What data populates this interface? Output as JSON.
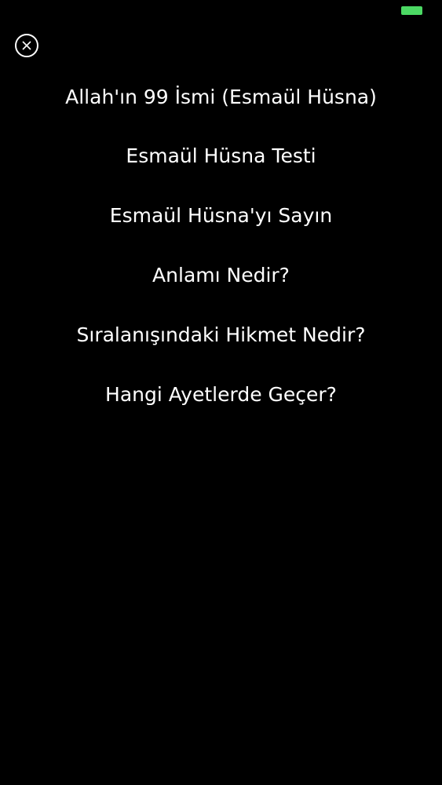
{
  "status_bar": {
    "battery_icon": "battery-icon",
    "battery_color": "#4cd964"
  },
  "close": {
    "icon": "close-icon"
  },
  "menu": {
    "items": [
      {
        "label": "Allah'ın 99 İsmi (Esmaül Hüsna)"
      },
      {
        "label": "Esmaül Hüsna Testi"
      },
      {
        "label": "Esmaül Hüsna'yı Sayın"
      },
      {
        "label": "Anlamı Nedir?"
      },
      {
        "label": "Sıralanışındaki Hikmet Nedir?"
      },
      {
        "label": "Hangi Ayetlerde Geçer?"
      }
    ]
  },
  "colors": {
    "background": "#000000",
    "text": "#ffffff"
  }
}
